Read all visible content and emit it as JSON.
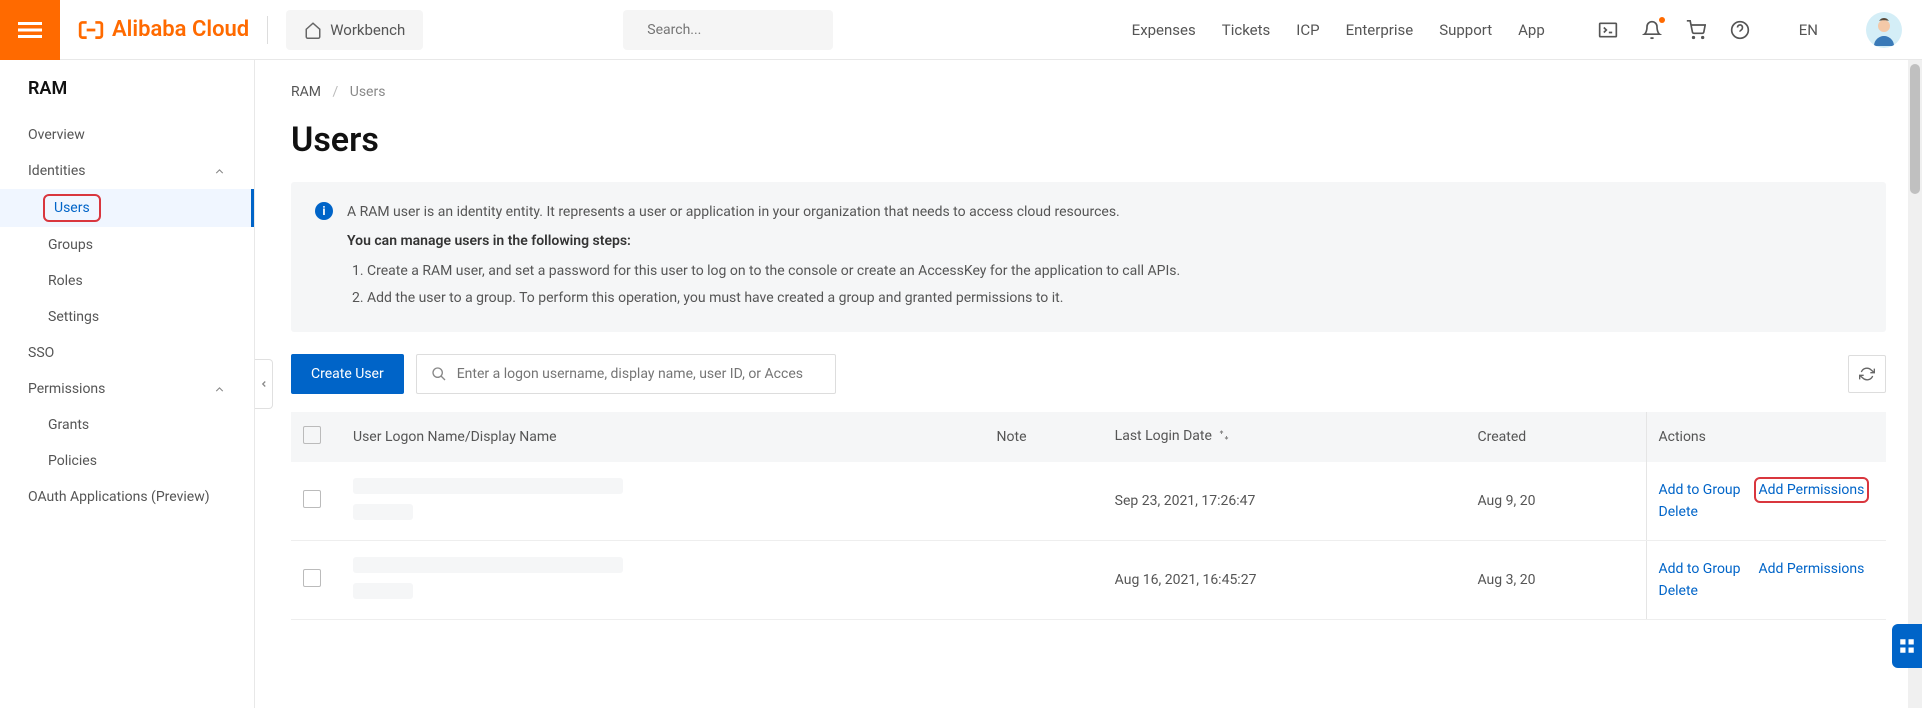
{
  "brand": "Alibaba Cloud",
  "workbench": "Workbench",
  "search_placeholder": "Search...",
  "topnav": {
    "expenses": "Expenses",
    "tickets": "Tickets",
    "icp": "ICP",
    "enterprise": "Enterprise",
    "support": "Support",
    "app": "App"
  },
  "lang": "EN",
  "sidebar": {
    "title": "RAM",
    "overview": "Overview",
    "identities": "Identities",
    "users": "Users",
    "groups": "Groups",
    "roles": "Roles",
    "settings": "Settings",
    "sso": "SSO",
    "permissions": "Permissions",
    "grants": "Grants",
    "policies": "Policies",
    "oauth": "OAuth Applications (Preview)"
  },
  "crumbs": {
    "root": "RAM",
    "leaf": "Users"
  },
  "h1": "Users",
  "info": {
    "p1": "A RAM user is an identity entity. It represents a user or application in your organization that needs to access cloud resources.",
    "p2": "You can manage users in the following steps:",
    "li1": "Create a RAM user, and set a password for this user to log on to the console or create an AccessKey for the application to call APIs.",
    "li2": "Add the user to a group. To perform this operation, you must have created a group and granted permissions to it."
  },
  "create_btn": "Create User",
  "filter_placeholder": "Enter a logon username, display name, user ID, or Acces",
  "cols": {
    "name": "User Logon Name/Display Name",
    "note": "Note",
    "last": "Last Login Date",
    "created": "Created",
    "actions": "Actions"
  },
  "rows": [
    {
      "last": "Sep 23, 2021, 17:26:47",
      "created": "Aug 9, 20",
      "add_group": "Add to Group",
      "add_perm": "Add Permissions",
      "delete": "Delete",
      "hl": true
    },
    {
      "last": "Aug 16, 2021, 16:45:27",
      "created": "Aug 3, 20",
      "add_group": "Add to Group",
      "add_perm": "Add Permissions",
      "delete": "Delete",
      "hl": false
    }
  ]
}
